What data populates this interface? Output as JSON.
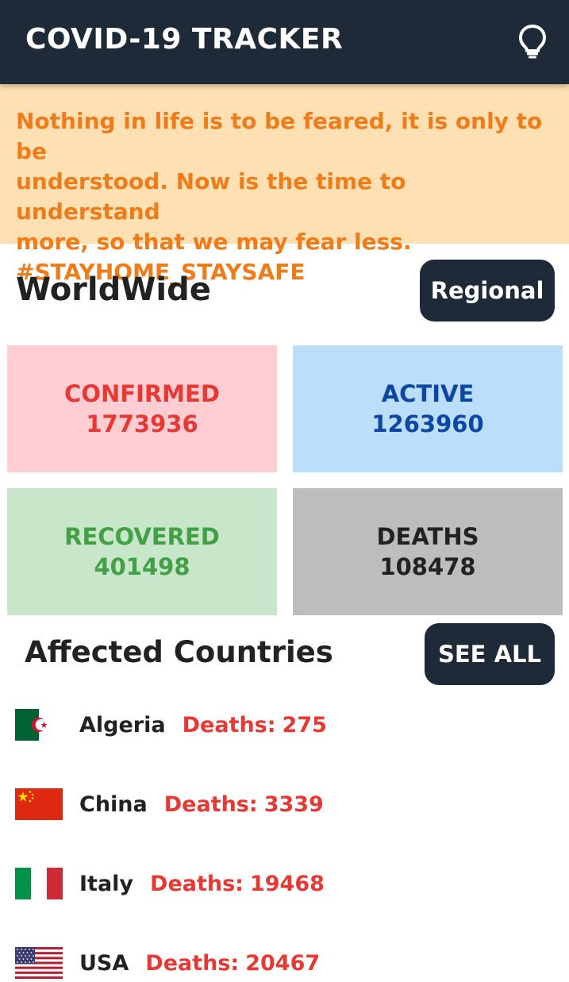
{
  "app": {
    "title": "COVID-19 TRACKER",
    "theme_toggle_icon": "lightbulb-icon"
  },
  "banner": {
    "quote": "Nothing in life is to be feared, it is only to be\nunderstood. Now is the time to understand\nmore, so that we may fear less.\n#STAYHOME_STAYSAFE"
  },
  "worldwide": {
    "title": "WorldWide",
    "regional_button": "Regional",
    "stats": {
      "confirmed": {
        "label": "CONFIRMED",
        "value": "1773936",
        "color": "#e53935",
        "bg": "#ffcdd2"
      },
      "active": {
        "label": "ACTIVE",
        "value": "1263960",
        "color": "#0d47a1",
        "bg": "#bbdefb"
      },
      "recovered": {
        "label": "RECOVERED",
        "value": "401498",
        "color": "#43a047",
        "bg": "#c8e6c9"
      },
      "deaths": {
        "label": "DEATHS",
        "value": "108478",
        "color": "#222222",
        "bg": "#bdbdbd"
      }
    }
  },
  "affected": {
    "title": "Affected Countries",
    "see_all_button": "SEE ALL",
    "countries": [
      {
        "name": "Algeria",
        "deaths_label": "Deaths:",
        "deaths": "275",
        "flag_icon": "algeria-flag-icon"
      },
      {
        "name": "China",
        "deaths_label": "Deaths:",
        "deaths": "3339",
        "flag_icon": "china-flag-icon"
      },
      {
        "name": "Italy",
        "deaths_label": "Deaths:",
        "deaths": "19468",
        "flag_icon": "italy-flag-icon"
      },
      {
        "name": "USA",
        "deaths_label": "Deaths:",
        "deaths": "20467",
        "flag_icon": "usa-flag-icon"
      }
    ]
  },
  "colors": {
    "appbar": "#1f2a38",
    "banner_bg": "#ffe0b2",
    "banner_text": "#ef7c1b",
    "deaths_text": "#e53935"
  }
}
